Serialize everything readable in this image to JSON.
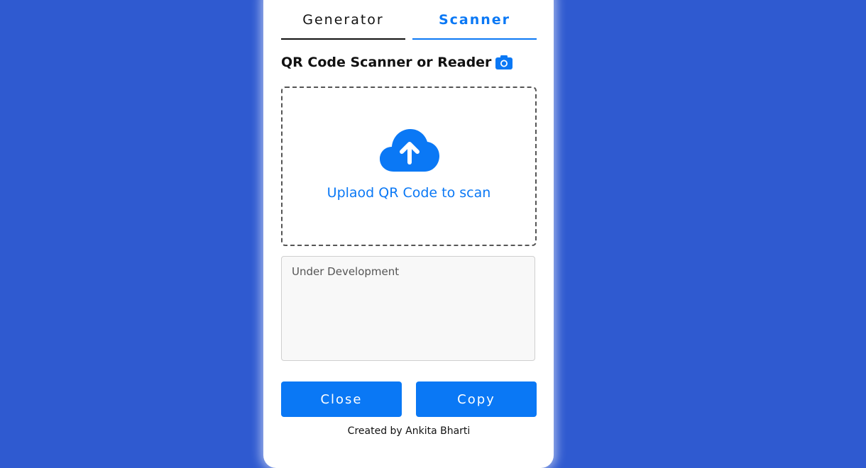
{
  "tabs": {
    "generator_label": "Generator",
    "scanner_label": "Scanner",
    "active": "Scanner"
  },
  "heading": {
    "title": "QR Code Scanner or Reader",
    "icon": "camera-icon"
  },
  "dropzone": {
    "icon": "cloud-upload-icon",
    "text": "Uplaod QR Code to scan"
  },
  "result": {
    "placeholder": "Under Development",
    "value": ""
  },
  "buttons": {
    "close_label": "Close",
    "copy_label": "Copy"
  },
  "footer": {
    "credit": "Created by Ankita Bharti"
  },
  "colors": {
    "background": "#2f5ad0",
    "accent": "#0a78f5",
    "card": "#ffffff"
  }
}
